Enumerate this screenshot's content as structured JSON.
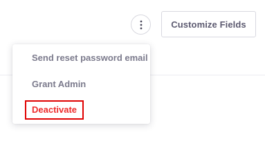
{
  "header": {
    "more_options_icon": "vertical-ellipsis-icon",
    "customize_fields_label": "Customize Fields"
  },
  "menu": {
    "items": [
      {
        "label": "Send reset password email"
      },
      {
        "label": "Grant Admin"
      },
      {
        "label": "Deactivate",
        "highlighted": true,
        "color": "#ee2b2b",
        "outline_color": "#e00000"
      }
    ]
  },
  "colors": {
    "text_muted": "#7b7a8c",
    "button_text": "#5c5a70",
    "border": "#d8d8df"
  }
}
